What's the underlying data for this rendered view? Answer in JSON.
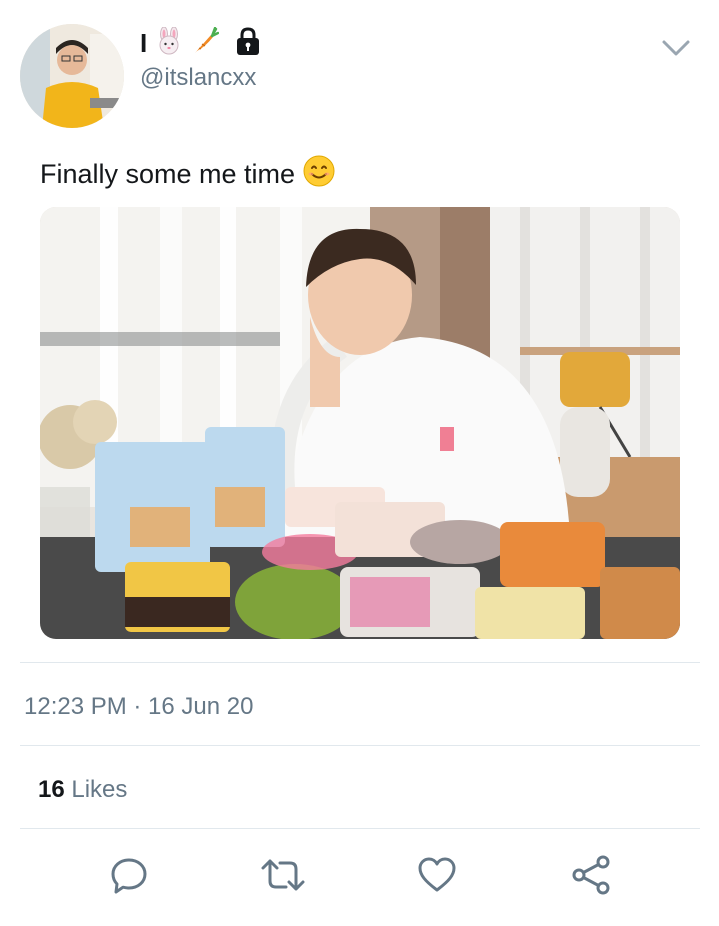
{
  "tweet": {
    "display_name": "I",
    "handle": "@itslancxx",
    "text": "Finally some me time",
    "text_emoji": "smiling-face-icon",
    "timestamp": "12:23 PM · 16 Jun 20",
    "likes_count": "16",
    "likes_label": "Likes"
  },
  "icons": {
    "name_emojis": [
      "rabbit-face-icon",
      "carrot-icon"
    ],
    "lock": "lock-icon",
    "menu": "chevron-down-icon",
    "actions": [
      "reply-icon",
      "retweet-icon",
      "like-icon",
      "share-icon"
    ]
  },
  "colors": {
    "text_primary": "#14171a",
    "text_secondary": "#657786",
    "icon_gray": "#657786",
    "divider": "#e1e8ed"
  }
}
